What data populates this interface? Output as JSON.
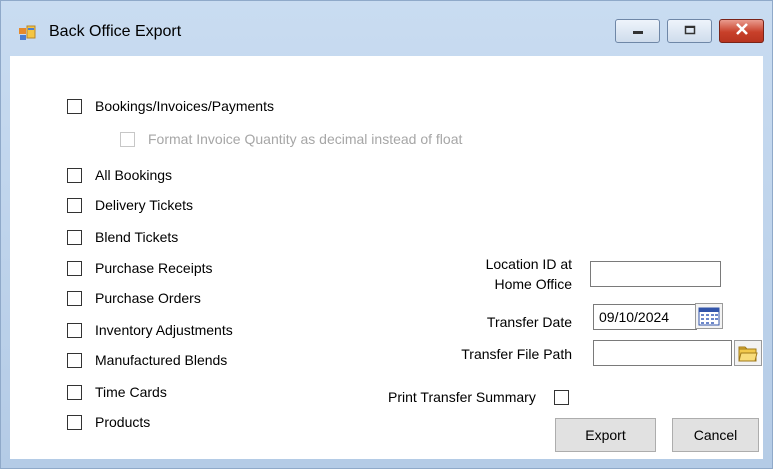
{
  "window": {
    "title": "Back Office Export",
    "icon": "app-window-icon",
    "controls": [
      "minimize-icon",
      "maximize-icon",
      "close-icon"
    ],
    "close_color": "#c8402a"
  },
  "export_options": {
    "bookings": {
      "label": "Bookings/Invoices/Payments",
      "checked": false
    },
    "format_invoice": {
      "label": "Format Invoice Quantity as decimal instead of float",
      "checked": false,
      "enabled": false
    },
    "all_bookings": {
      "label": "All Bookings",
      "checked": false
    },
    "delivery_tickets": {
      "label": "Delivery Tickets",
      "checked": false
    },
    "blend_tickets": {
      "label": "Blend Tickets",
      "checked": false
    },
    "purchase_receipts": {
      "label": "Purchase Receipts",
      "checked": false
    },
    "purchase_orders": {
      "label": "Purchase Orders",
      "checked": false
    },
    "inventory_adjustments": {
      "label": "Inventory Adjustments",
      "checked": false
    },
    "manufactured_blends": {
      "label": "Manufactured Blends",
      "checked": false
    },
    "time_cards": {
      "label": "Time Cards",
      "checked": false
    },
    "products": {
      "label": "Products",
      "checked": false
    }
  },
  "transfer": {
    "location_label_line1": "Location ID at",
    "location_label_line2": "Home Office",
    "location_value": "",
    "date_label": "Transfer Date",
    "date_value": "09/10/2024",
    "date_icon": "calendar-icon",
    "path_label": "Transfer File Path",
    "path_value": "",
    "path_icon": "folder-browse-icon",
    "summary_label": "Print Transfer Summary",
    "summary_checked": false
  },
  "buttons": {
    "export": "Export",
    "cancel": "Cancel"
  }
}
